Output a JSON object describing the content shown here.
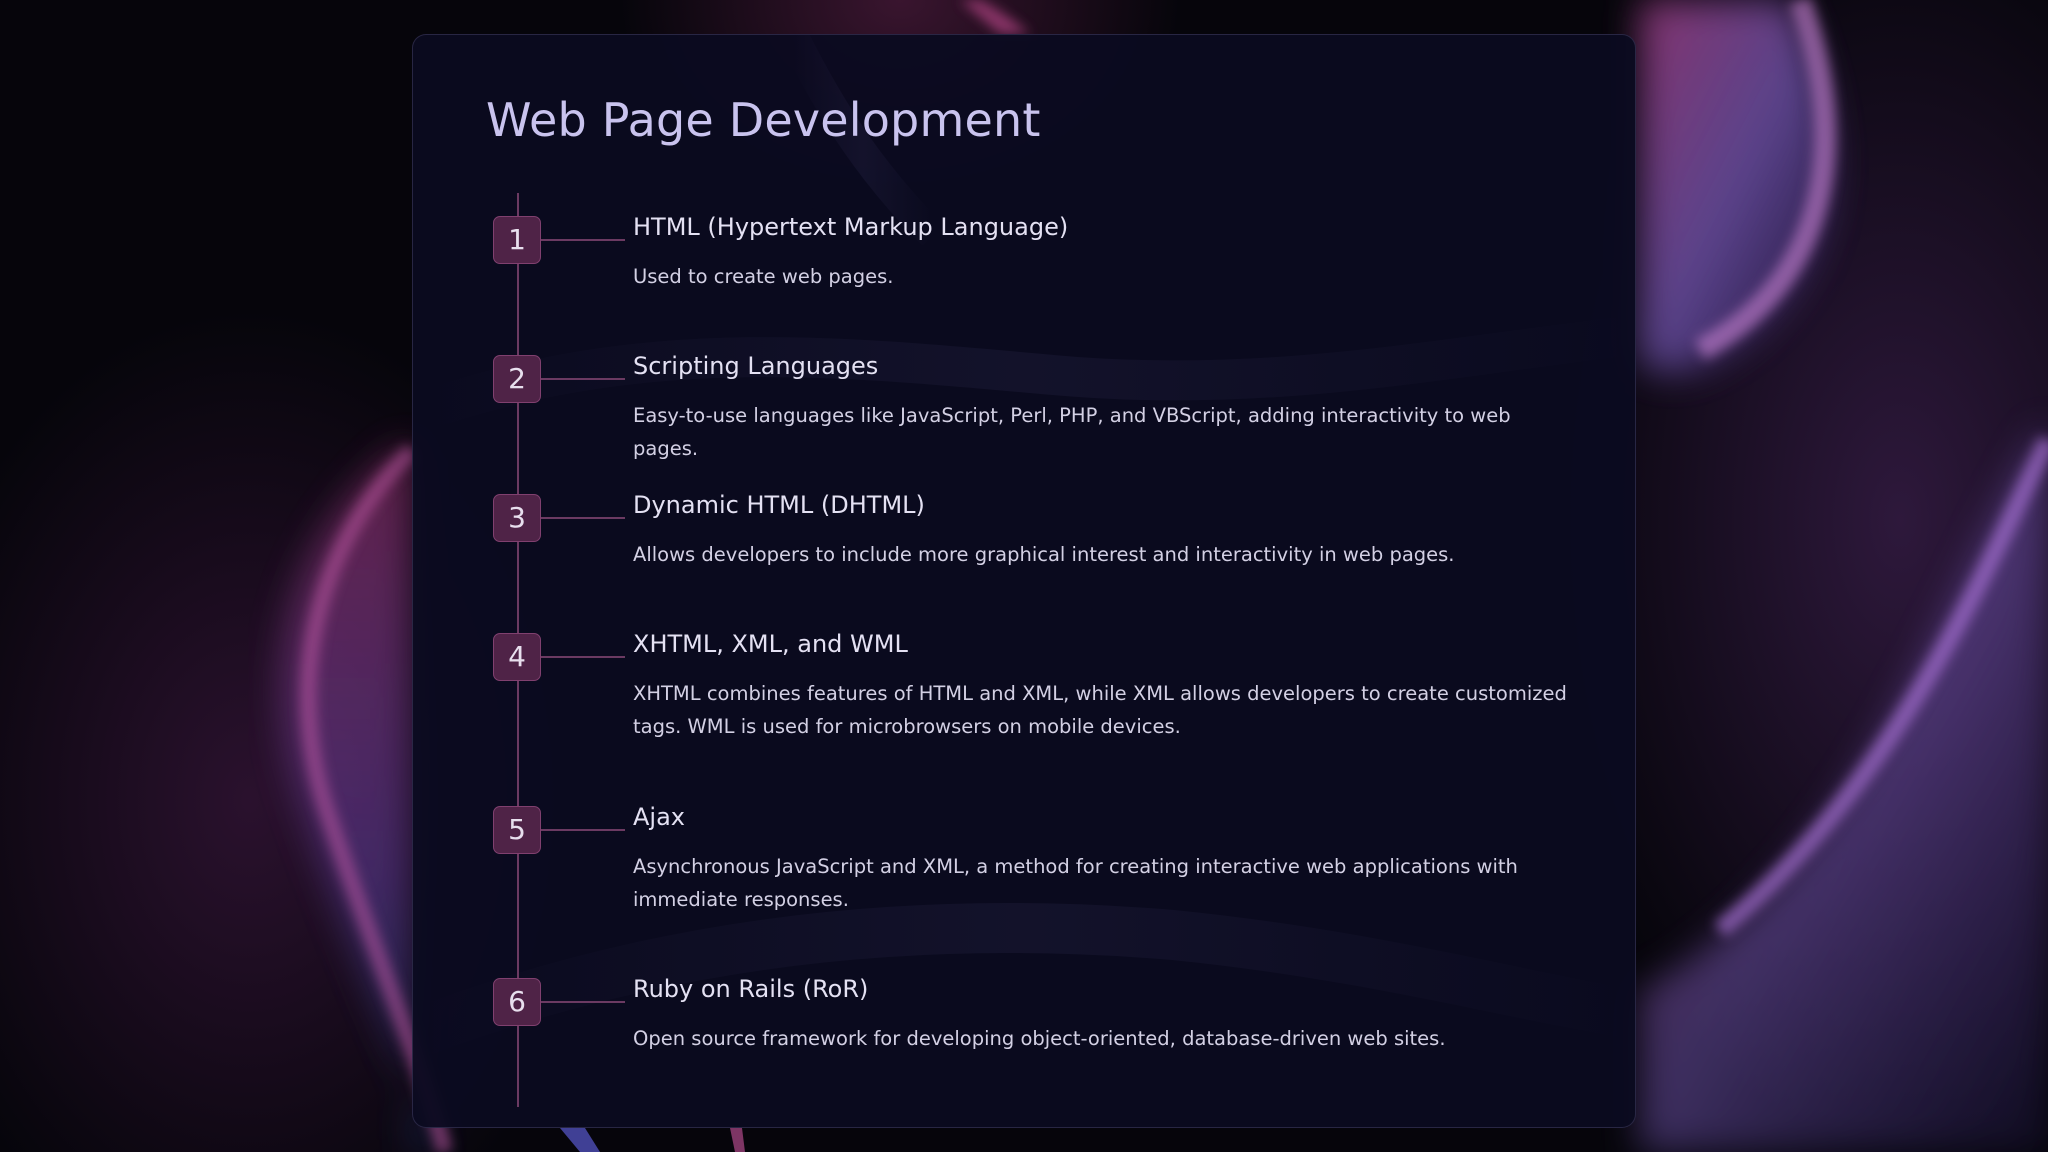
{
  "title": "Web Page Development",
  "steps": [
    {
      "number": "1",
      "title": "HTML (Hypertext Markup Language)",
      "description": "Used to create web pages."
    },
    {
      "number": "2",
      "title": "Scripting Languages",
      "description": "Easy-to-use languages like JavaScript, Perl, PHP, and VBScript, adding interactivity to web pages."
    },
    {
      "number": "3",
      "title": "Dynamic HTML (DHTML)",
      "description": "Allows developers to include more graphical interest and interactivity in web pages."
    },
    {
      "number": "4",
      "title": "XHTML, XML, and WML",
      "description": "XHTML combines features of HTML and XML, while XML allows developers to create customized tags. WML is used for microbrowsers on mobile devices."
    },
    {
      "number": "5",
      "title": "Ajax",
      "description": "Asynchronous JavaScript and XML, a method for creating interactive web applications with immediate responses."
    },
    {
      "number": "6",
      "title": "Ruby on Rails (RoR)",
      "description": "Open source framework for developing object-oriented, database-driven web sites."
    }
  ],
  "colors": {
    "background": "#06050b",
    "card": "#0b0b20",
    "title": "#c9c3ee",
    "accent": "#4f2347",
    "line": "#6b3a62"
  }
}
